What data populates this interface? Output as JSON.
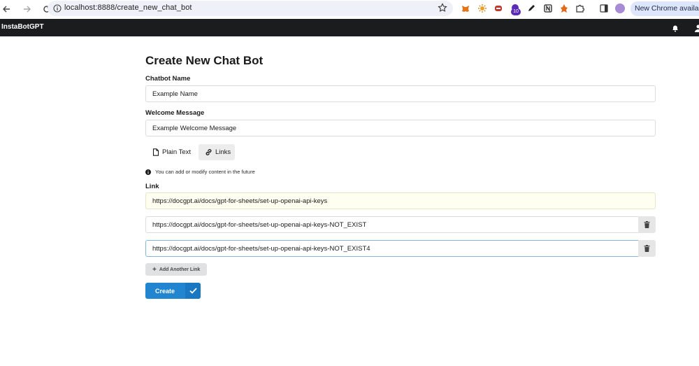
{
  "browser": {
    "url": "localhost:8888/create_new_chat_bot",
    "update_label": "New Chrome available",
    "extension_badge": "10"
  },
  "app": {
    "brand": "InstaBotGPT"
  },
  "form": {
    "title": "Create New Chat Bot",
    "name_label": "Chatbot Name",
    "name_value": "Example Name",
    "welcome_label": "Welcome Message",
    "welcome_value": "Example Welcome Message",
    "tabs": [
      {
        "label": "Plain Text",
        "icon": "file-icon"
      },
      {
        "label": "Links",
        "icon": "link-icon",
        "active": true
      }
    ],
    "notice": "You can add or modify content in the future",
    "link_label": "Link",
    "links": [
      "https://docgpt.ai/docs/gpt-for-sheets/set-up-openai-api-keys",
      "https://docgpt.ai/docs/gpt-for-sheets/set-up-openai-api-keys-NOT_EXIST",
      "https://docgpt.ai/docs/gpt-for-sheets/set-up-openai-api-keys-NOT_EXIST4"
    ],
    "add_link_label": "Add Another Link",
    "create_label": "Create"
  },
  "colors": {
    "primary": "#2185d0",
    "header_bg": "#1b1c1d",
    "autofill_bg": "#fefff0"
  }
}
